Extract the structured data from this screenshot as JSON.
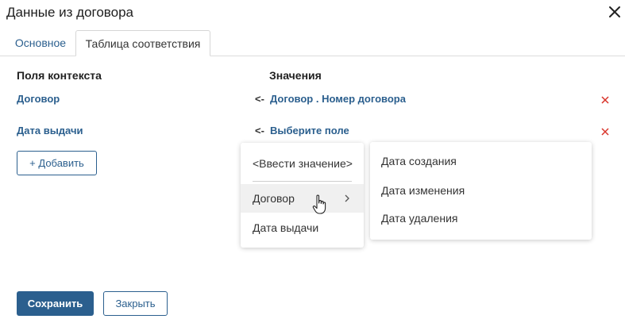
{
  "dialog": {
    "title": "Данные из договора"
  },
  "tabs": [
    {
      "label": "Основное"
    },
    {
      "label": "Таблица соответствия"
    }
  ],
  "table": {
    "context_header": "Поля контекста",
    "values_header": "Значения",
    "arrow": "<-",
    "rows": [
      {
        "field": "Договор",
        "value": "Договор . Номер договора"
      },
      {
        "field": "Дата выдачи",
        "value": "Выберите поле"
      }
    ]
  },
  "add_button": {
    "label": "+ Добавить"
  },
  "dropdown": {
    "items": [
      {
        "label": "<Ввести значение>"
      },
      {
        "label": "Договор"
      },
      {
        "label": "Дата выдачи"
      }
    ],
    "submenu": [
      {
        "label": "Дата создания"
      },
      {
        "label": "Дата изменения"
      },
      {
        "label": "Дата удаления"
      }
    ]
  },
  "footer": {
    "save_label": "Сохранить",
    "close_label": "Закрыть"
  },
  "colors": {
    "accent": "#2b5f8e",
    "delete": "#d9342b"
  },
  "icons": {
    "close": "close-icon",
    "delete": "delete-x-icon",
    "submenu": "chevron-right-icon",
    "pointer": "hand-pointer-icon"
  }
}
